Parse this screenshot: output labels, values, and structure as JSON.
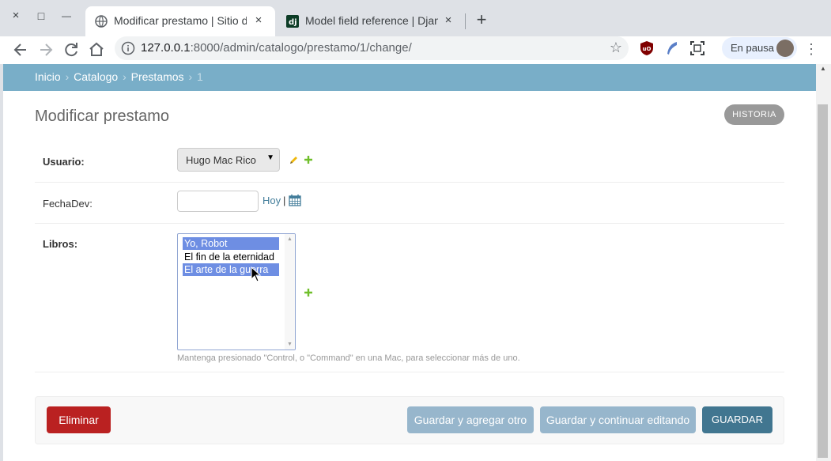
{
  "browser": {
    "tabs": [
      {
        "title": "Modificar prestamo | Sitio de a",
        "active": true
      },
      {
        "title": "Model field reference | Django",
        "active": false
      }
    ],
    "url_host": "127.0.0.1",
    "url_rest": ":8000/admin/catalogo/prestamo/1/change/",
    "profile_label": "En pausa",
    "icons": {
      "close": "×",
      "restore": "□",
      "minimize": "—",
      "new_tab": "+",
      "back": "arrow-left-icon",
      "forward": "arrow-right-icon",
      "reload": "reload-icon",
      "home": "home-icon",
      "info": "info-icon",
      "star": "☆",
      "menu": "⋮"
    }
  },
  "breadcrumbs": {
    "home": "Inicio",
    "app": "Catalogo",
    "model": "Prestamos",
    "current": "1",
    "sep": "›"
  },
  "page": {
    "title": "Modificar prestamo",
    "history_button": "HISTORIA"
  },
  "form": {
    "usuario": {
      "label": "Usuario:",
      "selected": "Hugo Mac Rico"
    },
    "fechadev": {
      "label": "FechaDev:",
      "value": "",
      "today_link": "Hoy",
      "separator": "|"
    },
    "libros": {
      "label": "Libros:",
      "options": [
        {
          "text": "Yo, Robot",
          "selected": true
        },
        {
          "text": "El fin de la eternidad",
          "selected": false
        },
        {
          "text": "El arte de la guerra",
          "selected": true
        }
      ],
      "help": "Mantenga presionado \"Control, o \"Command\" en una Mac, para seleccionar más de uno."
    }
  },
  "actions": {
    "delete": "Eliminar",
    "save_add_another": "Guardar y agregar otro",
    "save_continue": "Guardar y continuar editando",
    "save": "GUARDAR"
  },
  "colors": {
    "breadcrumb_bg": "#79aec8",
    "delete": "#ba2121",
    "save": "#417690",
    "secondary_buttons": "#97b6cc",
    "selected_option": "#6e8ee3",
    "link": "#447e9b"
  }
}
